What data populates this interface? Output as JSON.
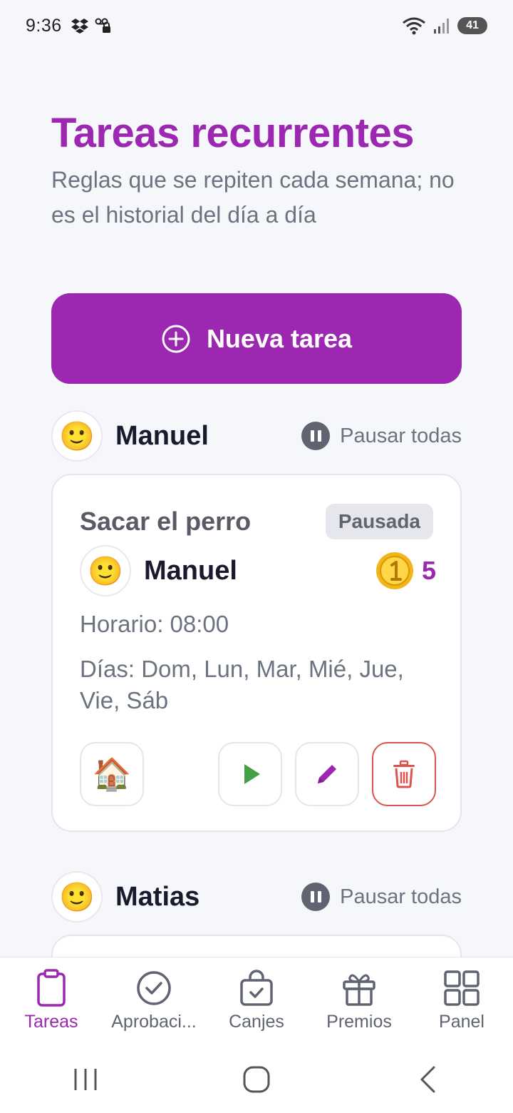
{
  "status_bar": {
    "time": "9:36",
    "battery": "41"
  },
  "header": {
    "title": "Tareas recurrentes",
    "subtitle": "Reglas que se repiten cada semana; no es el historial del día a día"
  },
  "new_task_button": {
    "label": "Nueva tarea"
  },
  "groups": [
    {
      "person": "Manuel",
      "avatar_emoji": "🙂",
      "pause_all_label": "Pausar todas"
    },
    {
      "person": "Matias",
      "avatar_emoji": "🙂",
      "pause_all_label": "Pausar todas"
    }
  ],
  "task": {
    "title": "Sacar el perro",
    "status": "Pausada",
    "assignee": "Manuel",
    "assignee_emoji": "🙂",
    "coin_emoji": "🪙",
    "coins": "5",
    "schedule": "Horario: 08:00",
    "days": "Días: Dom, Lun, Mar, Mié, Jue, Vie, Sáb",
    "category_emoji": "🏠"
  },
  "bottom_nav": [
    {
      "label": "Tareas",
      "icon": "clipboard-icon",
      "active": true
    },
    {
      "label": "Aprobaci...",
      "icon": "check-circle-icon",
      "active": false
    },
    {
      "label": "Canjes",
      "icon": "shopping-bag-check-icon",
      "active": false
    },
    {
      "label": "Premios",
      "icon": "gift-icon",
      "active": false
    },
    {
      "label": "Panel",
      "icon": "grid-icon",
      "active": false
    }
  ],
  "colors": {
    "accent": "#9c27b0",
    "muted": "#6b7280",
    "danger": "#d9534f",
    "play": "#43a047"
  }
}
